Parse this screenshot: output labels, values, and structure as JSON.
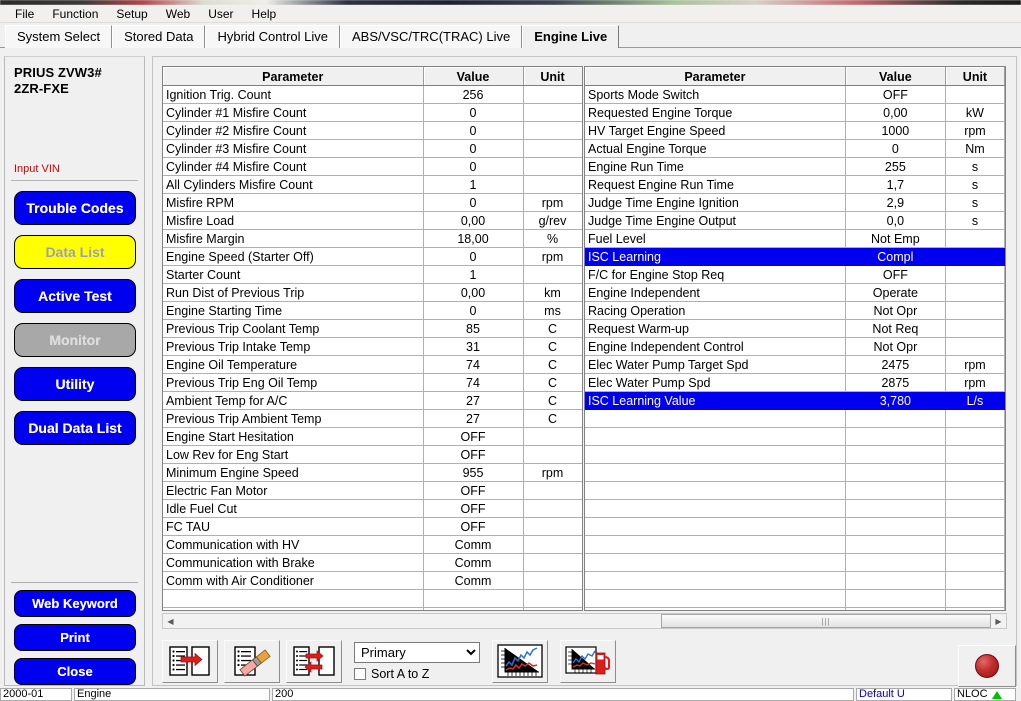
{
  "menu": {
    "items": [
      "File",
      "Function",
      "Setup",
      "Web",
      "User",
      "Help"
    ]
  },
  "tabs": [
    {
      "label": "System Select",
      "active": false
    },
    {
      "label": "Stored Data",
      "active": false
    },
    {
      "label": "Hybrid Control Live",
      "active": false
    },
    {
      "label": "ABS/VSC/TRC(TRAC) Live",
      "active": false
    },
    {
      "label": "Engine Live",
      "active": true
    }
  ],
  "sidebar": {
    "vehicle_line1": "PRIUS ZVW3#",
    "vehicle_line2": "2ZR-FXE",
    "input_vin": "Input VIN",
    "buttons": [
      {
        "label": "Trouble Codes",
        "state": "normal"
      },
      {
        "label": "Data List",
        "state": "active"
      },
      {
        "label": "Active Test",
        "state": "normal"
      },
      {
        "label": "Monitor",
        "state": "disabled"
      },
      {
        "label": "Utility",
        "state": "normal"
      },
      {
        "label": "Dual Data List",
        "state": "normal"
      }
    ],
    "footer_buttons": [
      {
        "label": "Web Keyword"
      },
      {
        "label": "Print"
      },
      {
        "label": "Close"
      }
    ]
  },
  "table": {
    "headers": {
      "parameter": "Parameter",
      "value": "Value",
      "unit": "Unit"
    },
    "left_rows": [
      {
        "parameter": "Ignition Trig. Count",
        "value": "256",
        "unit": "",
        "selected": false
      },
      {
        "parameter": "Cylinder #1 Misfire Count",
        "value": "0",
        "unit": "",
        "selected": false
      },
      {
        "parameter": "Cylinder #2 Misfire Count",
        "value": "0",
        "unit": "",
        "selected": false
      },
      {
        "parameter": "Cylinder #3 Misfire Count",
        "value": "0",
        "unit": "",
        "selected": false
      },
      {
        "parameter": "Cylinder #4 Misfire Count",
        "value": "0",
        "unit": "",
        "selected": false
      },
      {
        "parameter": "All Cylinders Misfire Count",
        "value": "1",
        "unit": "",
        "selected": false
      },
      {
        "parameter": "Misfire RPM",
        "value": "0",
        "unit": "rpm",
        "selected": false
      },
      {
        "parameter": "Misfire Load",
        "value": "0,00",
        "unit": "g/rev",
        "selected": false
      },
      {
        "parameter": "Misfire Margin",
        "value": "18,00",
        "unit": "%",
        "selected": false
      },
      {
        "parameter": "Engine Speed (Starter Off)",
        "value": "0",
        "unit": "rpm",
        "selected": false
      },
      {
        "parameter": "Starter Count",
        "value": "1",
        "unit": "",
        "selected": false
      },
      {
        "parameter": "Run Dist of Previous Trip",
        "value": "0,00",
        "unit": "km",
        "selected": false
      },
      {
        "parameter": "Engine Starting Time",
        "value": "0",
        "unit": "ms",
        "selected": false
      },
      {
        "parameter": "Previous Trip Coolant Temp",
        "value": "85",
        "unit": "C",
        "selected": false
      },
      {
        "parameter": "Previous Trip Intake Temp",
        "value": "31",
        "unit": "C",
        "selected": false
      },
      {
        "parameter": "Engine Oil Temperature",
        "value": "74",
        "unit": "C",
        "selected": false
      },
      {
        "parameter": "Previous Trip Eng Oil Temp",
        "value": "74",
        "unit": "C",
        "selected": false
      },
      {
        "parameter": "Ambient Temp for A/C",
        "value": "27",
        "unit": "C",
        "selected": false
      },
      {
        "parameter": "Previous Trip Ambient Temp",
        "value": "27",
        "unit": "C",
        "selected": false
      },
      {
        "parameter": "Engine Start Hesitation",
        "value": "OFF",
        "unit": "",
        "selected": false
      },
      {
        "parameter": "Low Rev for Eng Start",
        "value": "OFF",
        "unit": "",
        "selected": false
      },
      {
        "parameter": "Minimum Engine Speed",
        "value": "955",
        "unit": "rpm",
        "selected": false
      },
      {
        "parameter": "Electric Fan Motor",
        "value": "OFF",
        "unit": "",
        "selected": false
      },
      {
        "parameter": "Idle Fuel Cut",
        "value": "OFF",
        "unit": "",
        "selected": false
      },
      {
        "parameter": "FC TAU",
        "value": "OFF",
        "unit": "",
        "selected": false
      },
      {
        "parameter": "Communication with HV",
        "value": "Comm",
        "unit": "",
        "selected": false
      },
      {
        "parameter": "Communication with Brake",
        "value": "Comm",
        "unit": "",
        "selected": false
      },
      {
        "parameter": "Comm with Air Conditioner",
        "value": "Comm",
        "unit": "",
        "selected": false
      }
    ],
    "right_rows": [
      {
        "parameter": "Sports Mode Switch",
        "value": "OFF",
        "unit": "",
        "selected": false
      },
      {
        "parameter": "Requested Engine Torque",
        "value": "0,00",
        "unit": "kW",
        "selected": false
      },
      {
        "parameter": "HV Target Engine Speed",
        "value": "1000",
        "unit": "rpm",
        "selected": false
      },
      {
        "parameter": "Actual Engine Torque",
        "value": "0",
        "unit": "Nm",
        "selected": false
      },
      {
        "parameter": "Engine Run Time",
        "value": "255",
        "unit": "s",
        "selected": false
      },
      {
        "parameter": "Request Engine Run Time",
        "value": "1,7",
        "unit": "s",
        "selected": false
      },
      {
        "parameter": "Judge Time Engine Ignition",
        "value": "2,9",
        "unit": "s",
        "selected": false
      },
      {
        "parameter": "Judge Time Engine Output",
        "value": "0,0",
        "unit": "s",
        "selected": false
      },
      {
        "parameter": "Fuel Level",
        "value": "Not Emp",
        "unit": "",
        "selected": false
      },
      {
        "parameter": "ISC Learning",
        "value": "Compl",
        "unit": "",
        "selected": true
      },
      {
        "parameter": "F/C for Engine Stop Req",
        "value": "OFF",
        "unit": "",
        "selected": false
      },
      {
        "parameter": "Engine Independent",
        "value": "Operate",
        "unit": "",
        "selected": false
      },
      {
        "parameter": "Racing Operation",
        "value": "Not Opr",
        "unit": "",
        "selected": false
      },
      {
        "parameter": "Request Warm-up",
        "value": "Not Req",
        "unit": "",
        "selected": false
      },
      {
        "parameter": "Engine Independent Control",
        "value": "Not Opr",
        "unit": "",
        "selected": false
      },
      {
        "parameter": "Elec Water Pump Target Spd",
        "value": "2475",
        "unit": "rpm",
        "selected": false
      },
      {
        "parameter": "Elec Water Pump Spd",
        "value": "2875",
        "unit": "rpm",
        "selected": false
      },
      {
        "parameter": "ISC Learning Value",
        "value": "3,780",
        "unit": "L/s",
        "selected": true
      }
    ]
  },
  "toolbar": {
    "buttons": [
      {
        "name": "move-to-list-icon"
      },
      {
        "name": "erase-list-icon"
      },
      {
        "name": "swap-list-icon"
      },
      {
        "name": "graph-icon"
      },
      {
        "name": "fuel-graph-icon"
      }
    ],
    "select_value": "Primary",
    "select_options": [
      "Primary"
    ],
    "sort_label": "Sort A to Z",
    "sort_checked": false,
    "record_button": "record-button"
  },
  "statusbar": {
    "cell1": "2000-01",
    "cell2": "Engine",
    "cell3": "200",
    "cell4": "Default U",
    "cell5": "NLOC"
  },
  "colors": {
    "accent_blue": "#0000f0",
    "selection_blue": "#0000ee",
    "active_yellow": "#ffff00",
    "vin_red": "#d40000",
    "record_red": "#c42b2b"
  }
}
